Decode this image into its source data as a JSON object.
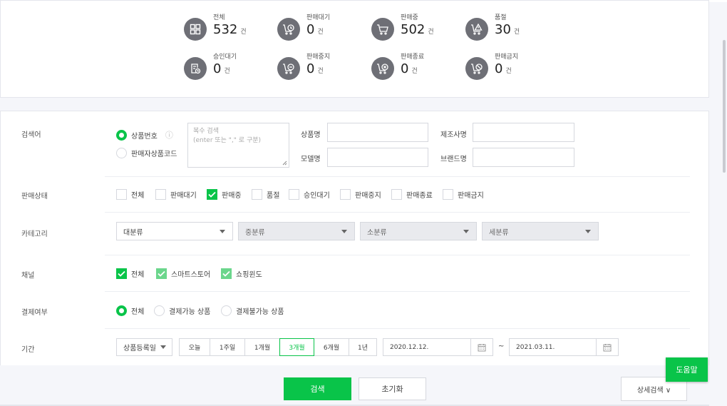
{
  "summary": [
    {
      "label": "전체",
      "count": "532",
      "unit": "건",
      "icon": "grid-icon"
    },
    {
      "label": "판매대기",
      "count": "0",
      "unit": "건",
      "icon": "cart-clock-icon"
    },
    {
      "label": "판매중",
      "count": "502",
      "unit": "건",
      "icon": "cart-icon"
    },
    {
      "label": "품절",
      "count": "30",
      "unit": "건",
      "icon": "cart-warning-icon"
    },
    {
      "label": "승인대기",
      "count": "0",
      "unit": "건",
      "icon": "doc-clock-icon"
    },
    {
      "label": "판매중지",
      "count": "0",
      "unit": "건",
      "icon": "cart-minus-icon"
    },
    {
      "label": "판매종료",
      "count": "0",
      "unit": "건",
      "icon": "cart-x-icon"
    },
    {
      "label": "판매금지",
      "count": "0",
      "unit": "건",
      "icon": "cart-ban-icon"
    }
  ],
  "search": {
    "label": "검색어",
    "radio_product_no": "상품번호",
    "radio_seller_code": "판매자상품코드",
    "multi_placeholder_1": "복수 검색",
    "multi_placeholder_2": "(enter 또는 \",\" 로 구분)",
    "product_name_label": "상품명",
    "manufacturer_label": "제조사명",
    "model_label": "모델명",
    "brand_label": "브랜드명",
    "info_icon": "ⓘ"
  },
  "status": {
    "label": "판매상태",
    "options": [
      {
        "label": "전체",
        "checked": false
      },
      {
        "label": "판매대기",
        "checked": false
      },
      {
        "label": "판매중",
        "checked": true
      },
      {
        "label": "품절",
        "checked": false
      },
      {
        "label": "승인대기",
        "checked": false
      },
      {
        "label": "판매중지",
        "checked": false
      },
      {
        "label": "판매종료",
        "checked": false
      },
      {
        "label": "판매금지",
        "checked": false
      }
    ]
  },
  "category": {
    "label": "카테고리",
    "selects": [
      "대분류",
      "중분류",
      "소분류",
      "세분류"
    ]
  },
  "channel": {
    "label": "채널",
    "options": [
      "전체",
      "스마트스토어",
      "쇼핑윈도"
    ]
  },
  "payment": {
    "label": "결제여부",
    "options": [
      "전체",
      "결제가능 상품",
      "결제불가능 상품"
    ]
  },
  "period": {
    "label": "기간",
    "type_select": "상품등록일",
    "buttons": [
      "오늘",
      "1주일",
      "1개월",
      "3개월",
      "6개월",
      "1년"
    ],
    "active": "3개월",
    "start_date": "2020.12.12.",
    "end_date": "2021.03.11.",
    "tilde": "~"
  },
  "actions": {
    "search": "검색",
    "reset": "초기화",
    "detail": "상세검색 ∨",
    "help": "도움말"
  },
  "colors": {
    "accent": "#09c449",
    "icon_bg": "#6e6f76"
  }
}
